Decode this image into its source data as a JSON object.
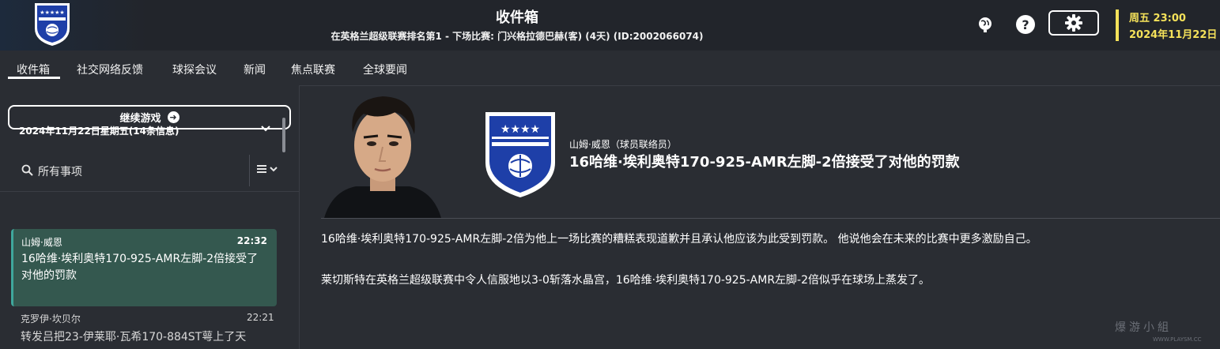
{
  "header": {
    "title": "收件箱",
    "subtitle": "在英格兰超级联赛排名第1 - 下场比赛: 门兴格拉德巴赫(客) (4天) (ID:2002066074)",
    "clock_day": "周五 23:00",
    "clock_date": "2024年11月22日",
    "accent_color": "#f5e25a"
  },
  "tabs": [
    {
      "label": "收件箱",
      "active": true
    },
    {
      "label": "社交网络反馈"
    },
    {
      "label": "球探会议"
    },
    {
      "label": "新闻"
    },
    {
      "label": "焦点联赛"
    },
    {
      "label": "全球要闻"
    }
  ],
  "sidebar": {
    "continue_label": "继续游戏",
    "filter_label": "所有事项",
    "date_group": "2024年11月22日星期五(14条信息)",
    "messages": [
      {
        "sender": "山姆·威恩",
        "time": "22:32",
        "subject": "16哈维·埃利奥特170-925-AMR左脚-2倍接受了对他的罚款",
        "selected": true
      },
      {
        "sender": "克罗伊·坎贝尔",
        "time": "22:21",
        "subject": "转发吕把23-伊莱耶·瓦希170-884ST萼上了天"
      }
    ]
  },
  "message": {
    "sender": "山姆·威恩（球员联络员）",
    "headline": "16哈维·埃利奥特170-925-AMR左脚-2倍接受了对他的罚款",
    "body": [
      "16哈维·埃利奥特170-925-AMR左脚-2倍为他上一场比赛的糟糕表现道歉并且承认他应该为此受到罚款。 他说他会在未来的比赛中更多激励自己。",
      "莱切斯特在英格兰超级联赛中令人信服地以3-0斩落水晶宫，16哈维·埃利奥特170-925-AMR左脚-2倍似乎在球场上蒸发了。"
    ]
  },
  "watermark": {
    "text": "爆游小組",
    "sub": "WWW.PLAYSM.CC"
  },
  "icons": [
    "club-badge-icon",
    "globe-icon",
    "help-icon",
    "gear-icon",
    "arrow-right-icon",
    "search-icon",
    "sort-icon",
    "chevron-down-icon"
  ]
}
